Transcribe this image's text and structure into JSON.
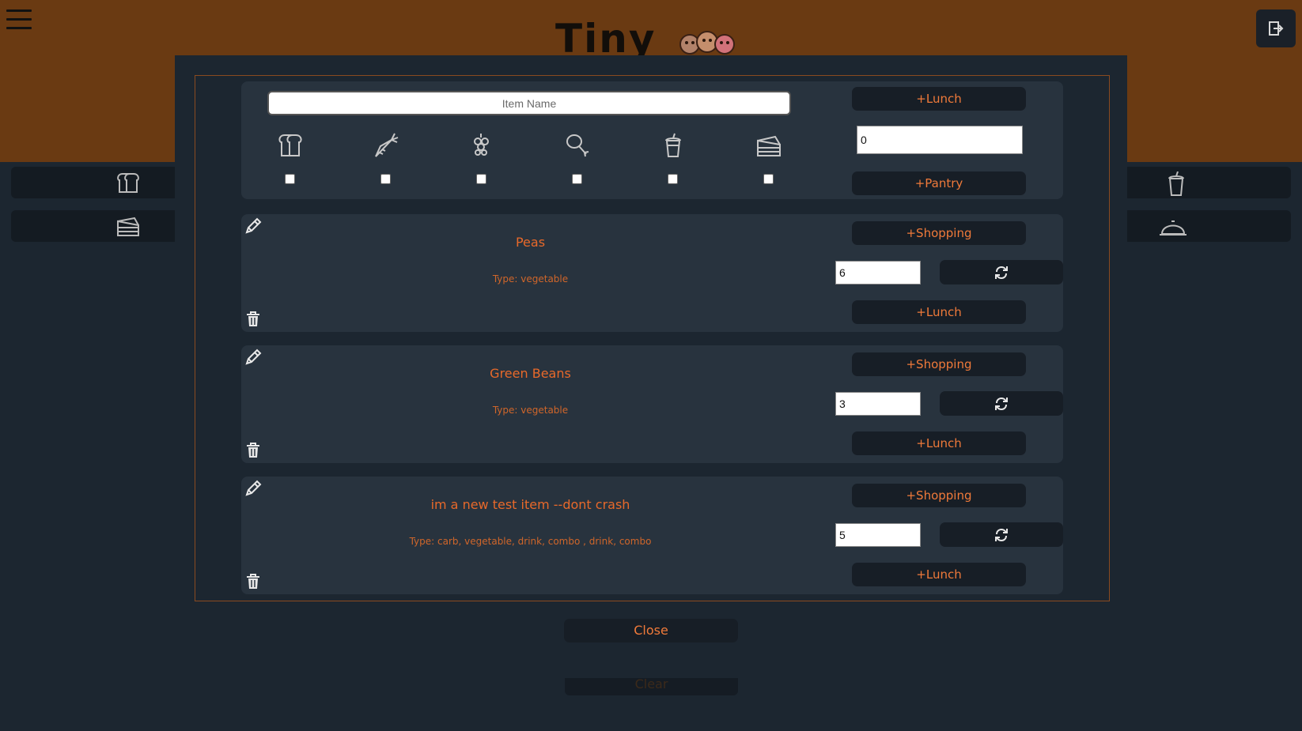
{
  "app": {
    "title": "Tiny",
    "clear_label": "Clear"
  },
  "form": {
    "name_placeholder": "Item Name",
    "lunch_label": "+Lunch",
    "pantry_label": "+Pantry",
    "quantity_value": "0",
    "types": [
      "carb-icon",
      "vegetable-icon",
      "fruit-icon",
      "protein-icon",
      "drink-icon",
      "dessert-icon"
    ]
  },
  "items": [
    {
      "name": "Peas",
      "type": "Type: vegetable",
      "quantity": "6",
      "shopping_label": "+Shopping",
      "lunch_label": "+Lunch"
    },
    {
      "name": "Green Beans",
      "type": "Type: vegetable",
      "quantity": "3",
      "shopping_label": "+Shopping",
      "lunch_label": "+Lunch"
    },
    {
      "name": "im a new test item --dont crash",
      "type": "Type: carb, vegetable, drink, combo , drink, combo",
      "quantity": "5",
      "shopping_label": "+Shopping",
      "lunch_label": "+Lunch"
    }
  ],
  "modal": {
    "close_label": "Close"
  },
  "colors": {
    "accent": "#f07a3a",
    "header": "#6a3a12",
    "panel": "#28333e",
    "background": "#1c2630"
  }
}
